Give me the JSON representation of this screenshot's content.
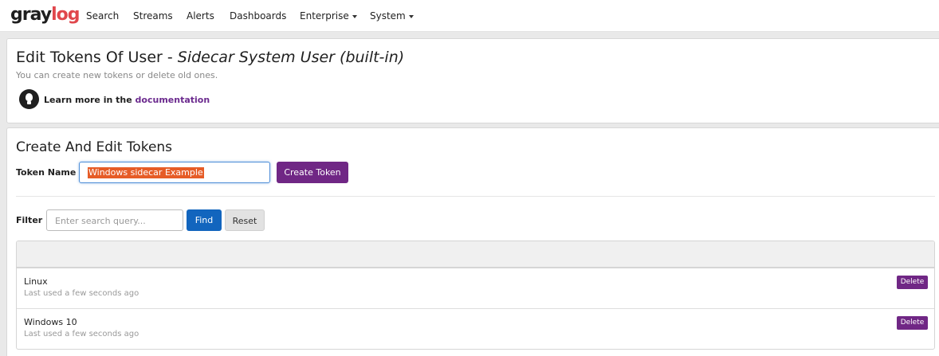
{
  "brand": {
    "logo_main": "gray",
    "logo_accent": "log"
  },
  "nav": {
    "search": "Search",
    "streams": "Streams",
    "alerts": "Alerts",
    "dashboards": "Dashboards",
    "enterprise": "Enterprise",
    "system": "System"
  },
  "header": {
    "title_prefix": "Edit Tokens Of User - ",
    "title_user": "Sidecar System User (built-in)",
    "subtitle": "You can create new tokens or delete old ones.",
    "doc_text": "Learn more in the",
    "doc_link": "documentation"
  },
  "tokens_panel": {
    "title": "Create And Edit Tokens",
    "token_name_label": "Token Name",
    "token_name_value": "Windows sidecar Example",
    "create_button": "Create Token",
    "filter_label": "Filter",
    "filter_placeholder": "Enter search query...",
    "find_button": "Find",
    "reset_button": "Reset"
  },
  "tokens": [
    {
      "name": "Linux",
      "last_used": "Last used a few seconds ago",
      "delete_label": "Delete"
    },
    {
      "name": "Windows 10",
      "last_used": "Last used a few seconds ago",
      "delete_label": "Delete"
    }
  ],
  "colors": {
    "brand_purple": "#702785",
    "find_blue": "#1265be",
    "logo_red": "#e0474c",
    "selection_orange": "#e65c27"
  },
  "icons": {
    "documentation": "lightbulb-icon",
    "dropdown": "caret-down-icon"
  }
}
